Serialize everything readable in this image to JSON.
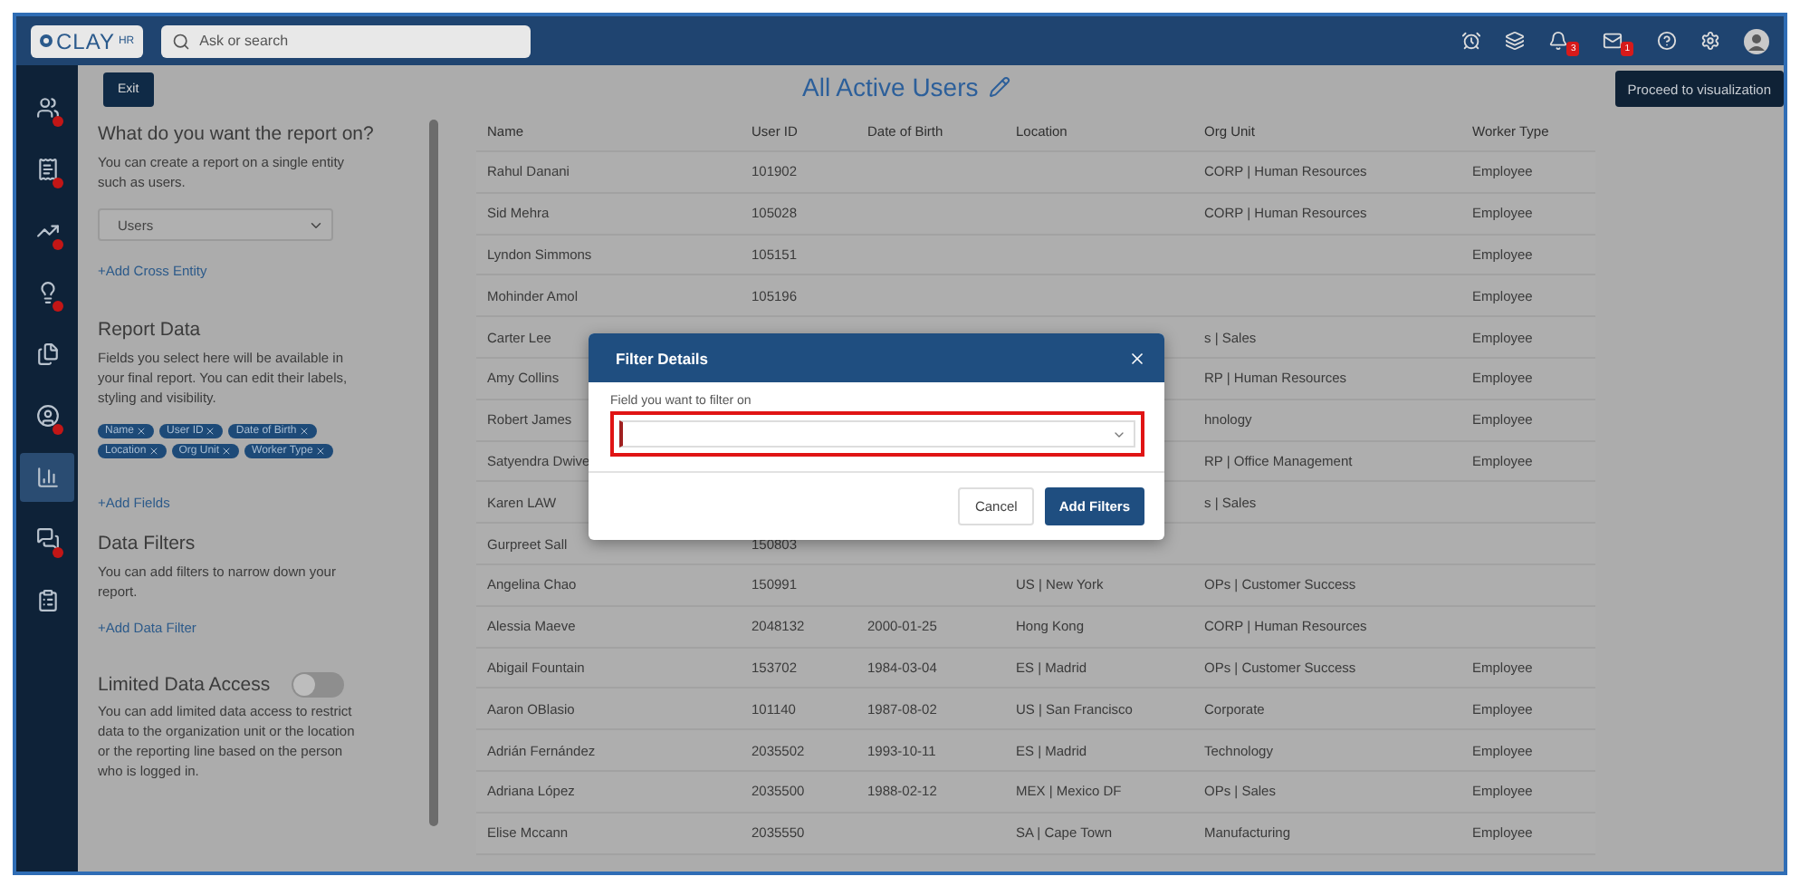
{
  "topbar": {
    "logo": {
      "brand": "CLAY",
      "suffix": "HR"
    },
    "search": {
      "placeholder": "Ask or search"
    },
    "notifications_badge": "3",
    "messages_badge": "1"
  },
  "sidebar": {
    "items": [
      {
        "alert": true,
        "selected": false
      },
      {
        "alert": true,
        "selected": false
      },
      {
        "alert": true,
        "selected": false
      },
      {
        "alert": true,
        "selected": false
      },
      {
        "alert": false,
        "selected": false
      },
      {
        "alert": true,
        "selected": false
      },
      {
        "alert": false,
        "selected": true
      },
      {
        "alert": true,
        "selected": false
      },
      {
        "alert": false,
        "selected": false
      }
    ]
  },
  "header": {
    "exit": "Exit",
    "title": "All Active Users",
    "proceed": "Proceed to visualization"
  },
  "panel": {
    "entity": {
      "heading": "What do you want the report on?",
      "text": "You can create a report on a single entity such as users.",
      "select": "Users",
      "link": "+Add Cross Entity"
    },
    "report_data": {
      "heading": "Report Data",
      "text": "Fields you select here will be available in your final report. You can edit their labels, styling and visibility.",
      "chips": [
        "Name",
        "User ID",
        "Date of Birth",
        "Location",
        "Org Unit",
        "Worker Type"
      ],
      "link": "+Add Fields"
    },
    "filters": {
      "heading": "Data Filters",
      "text": "You can add filters to narrow down your report.",
      "link": "+Add Data Filter"
    },
    "limited": {
      "heading": "Limited Data Access",
      "on": false,
      "text": "You can add limited data access to restrict data to the organization unit or the location or the reporting line based on the person who is logged in."
    }
  },
  "table": {
    "columns": [
      "Name",
      "User ID",
      "Date of Birth",
      "Location",
      "Org Unit",
      "Worker Type"
    ],
    "rows": [
      {
        "name": "Rahul Danani",
        "user_id": "101902",
        "org_unit": "CORP | Human Resources",
        "worker_type": "Employee"
      },
      {
        "name": "Sid Mehra",
        "user_id": "105028",
        "org_unit": "CORP | Human Resources",
        "worker_type": "Employee"
      },
      {
        "name": "Lyndon Simmons",
        "user_id": "105151",
        "worker_type": "Employee"
      },
      {
        "name": "Mohinder Amol",
        "user_id": "105196",
        "worker_type": "Employee"
      },
      {
        "name": "Carter Lee",
        "org_unit": "s | Sales",
        "worker_type": "Employee"
      },
      {
        "name": "Amy Collins",
        "org_unit": "RP | Human Resources",
        "worker_type": "Employee"
      },
      {
        "name": "Robert James",
        "org_unit": "hnology",
        "worker_type": "Employee"
      },
      {
        "name": "Satyendra Dwive",
        "org_unit": "RP | Office Management",
        "worker_type": "Employee"
      },
      {
        "name": "Karen LAW",
        "org_unit": "s | Sales"
      },
      {
        "name": "Gurpreet Sall",
        "user_id": "150803"
      },
      {
        "name": "Angelina Chao",
        "user_id": "150991",
        "location": "US | New York",
        "org_unit": "OPs | Customer Success"
      },
      {
        "name": "Alessia Maeve",
        "user_id": "2048132",
        "date_of_birth": "2000-01-25",
        "location": "Hong Kong",
        "org_unit": "CORP | Human Resources"
      },
      {
        "name": "Abigail Fountain",
        "user_id": "153702",
        "date_of_birth": "1984-03-04",
        "location": "ES | Madrid",
        "org_unit": "OPs | Customer Success",
        "worker_type": "Employee"
      },
      {
        "name": "Aaron OBlasio",
        "user_id": "101140",
        "date_of_birth": "1987-08-02",
        "location": "US | San Francisco",
        "org_unit": "Corporate",
        "worker_type": "Employee"
      },
      {
        "name": "Adrián Fernández",
        "user_id": "2035502",
        "date_of_birth": "1993-10-11",
        "location": "ES | Madrid",
        "org_unit": "Technology",
        "worker_type": "Employee"
      },
      {
        "name": "Adriana López",
        "user_id": "2035500",
        "date_of_birth": "1988-02-12",
        "location": "MEX | Mexico DF",
        "org_unit": "OPs | Sales",
        "worker_type": "Employee"
      },
      {
        "name": "Elise Mccann",
        "user_id": "2035550",
        "location": "SA | Cape Town",
        "org_unit": "Manufacturing",
        "worker_type": "Employee"
      }
    ]
  },
  "modal": {
    "title": "Filter Details",
    "field_label": "Field you want to filter on",
    "highlighted": true,
    "buttons": [
      {
        "label": "Cancel",
        "kind": "secondary"
      },
      {
        "label": "Add Filters",
        "kind": "primary"
      }
    ]
  }
}
